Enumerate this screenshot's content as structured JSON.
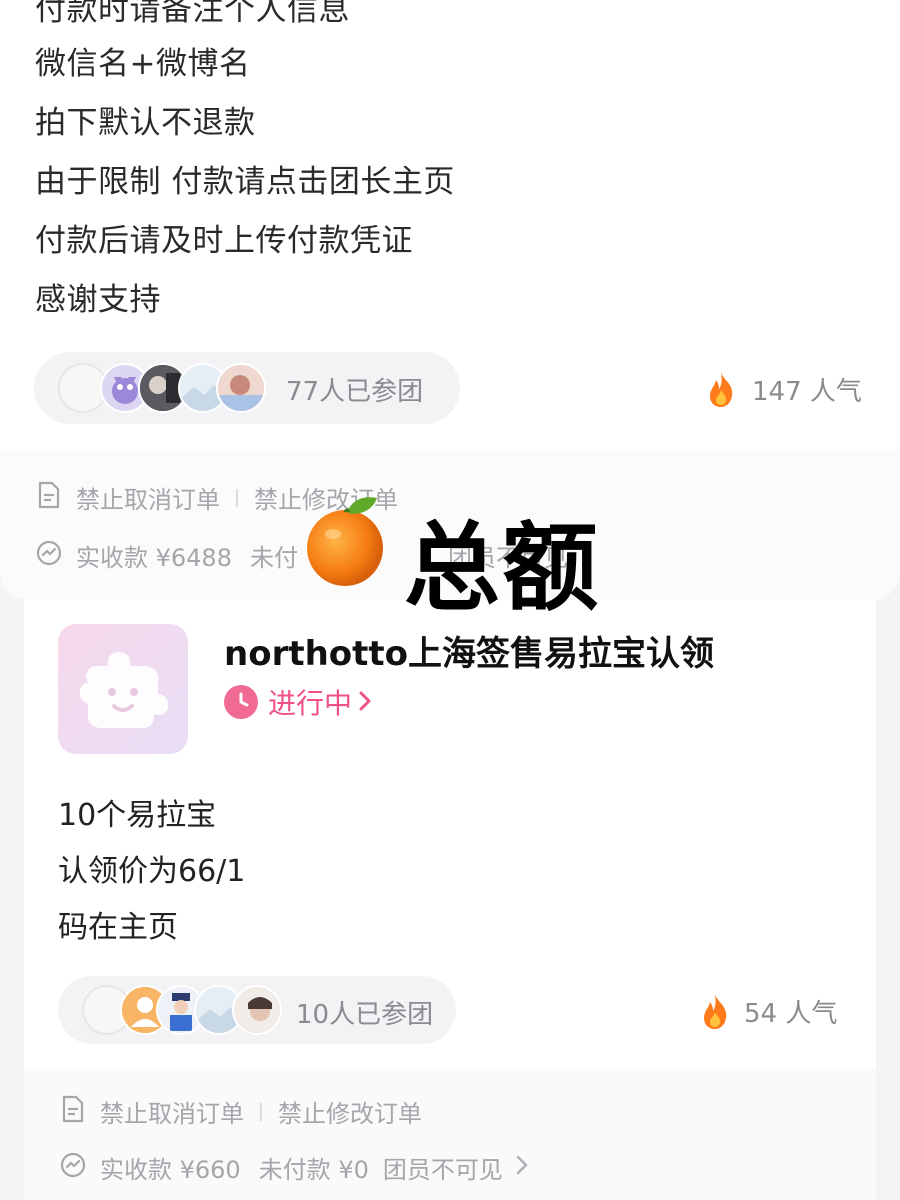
{
  "card1": {
    "description_lines": [
      "付款时请备注个人信息",
      "微信名+微博名",
      "拍下默认不退款",
      "由于限制 付款请点击团长主页",
      "付款后请及时上传付款凭证",
      "感谢支持"
    ],
    "participants_text": "77人已参团",
    "popularity_value": "147",
    "popularity_label": "人气",
    "rule_cancel": "禁止取消订单",
    "rule_modify": "禁止修改订单",
    "received": "实收款 ¥6488",
    "unpaid_partial": "未付",
    "visibility_partial": "团员不可见"
  },
  "overlay": {
    "text": "总额"
  },
  "card2": {
    "title": "northotto上海签售易拉宝认领",
    "status": "进行中",
    "description_lines": [
      "10个易拉宝",
      "认领价为66/1",
      "码在主页"
    ],
    "participants_text": "10人已参团",
    "popularity_value": "54",
    "popularity_label": "人气",
    "rule_cancel": "禁止取消订单",
    "rule_modify": "禁止修改订单",
    "received": "实收款 ¥660",
    "unpaid": "未付款 ¥0",
    "visibility": "团员不可见"
  },
  "colors": {
    "accent_pink": "#f0508a",
    "fire_orange": "#ff7a1a",
    "muted_gray": "#8a8a8f"
  },
  "icons": [
    "document-icon",
    "money-icon",
    "fire-icon",
    "clock-icon",
    "chevron-right-icon",
    "orange-emoji-icon",
    "puzzle-icon"
  ]
}
